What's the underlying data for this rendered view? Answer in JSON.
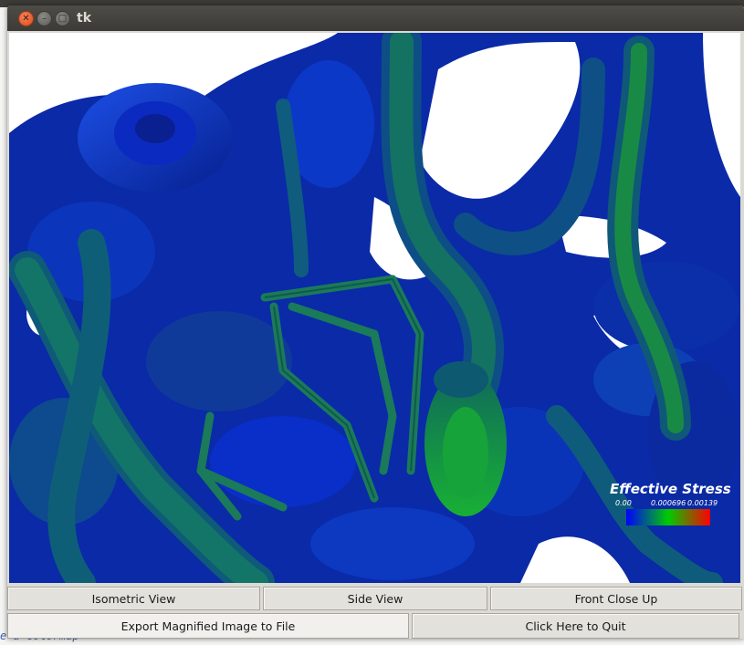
{
  "window": {
    "title": "tk"
  },
  "background_editor": {
    "bottom_text": "e a colormap"
  },
  "legend": {
    "title": "Effective Stress",
    "ticks": [
      "0.00",
      "0.000696",
      "0.00139"
    ],
    "colors": [
      "#0000ff",
      "#00cc00",
      "#ff0000"
    ]
  },
  "buttons_row1": {
    "isometric": "Isometric View",
    "side": "Side View",
    "front": "Front Close Up"
  },
  "buttons_row2": {
    "export": "Export Magnified Image to File",
    "quit": "Click Here to Quit"
  },
  "colors": {
    "background": "#ffffff",
    "tube_blue": "#0a2fd0",
    "tube_teal": "#0f6a6a",
    "tube_green": "#1aa83a"
  }
}
